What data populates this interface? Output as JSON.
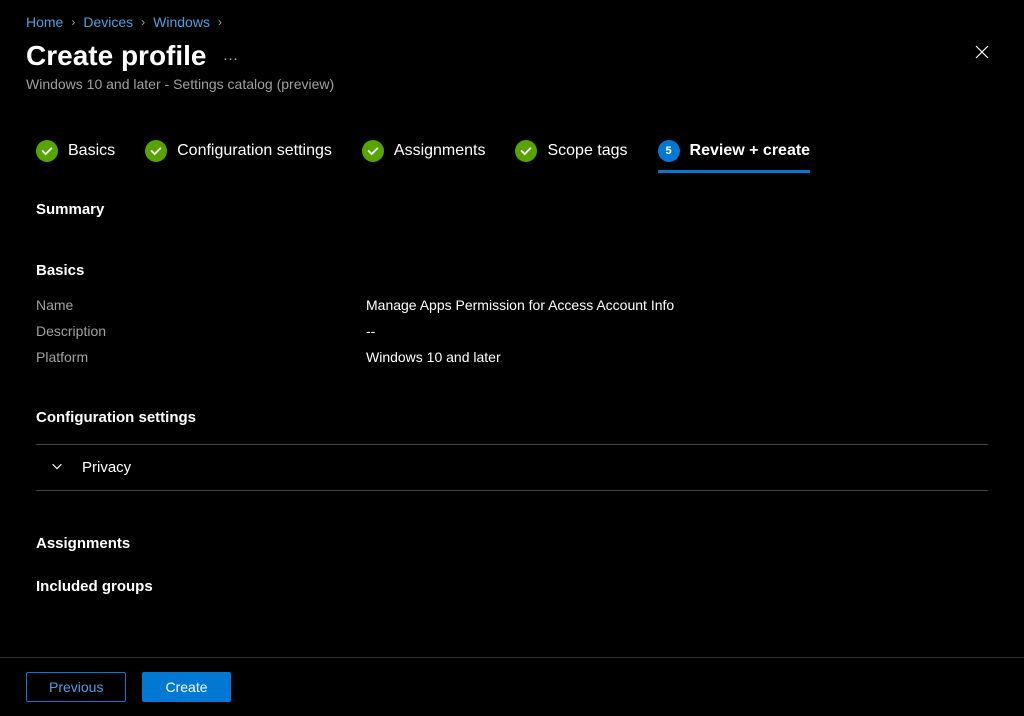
{
  "breadcrumb": {
    "items": [
      "Home",
      "Devices",
      "Windows"
    ]
  },
  "header": {
    "title": "Create profile",
    "subtitle": "Windows 10 and later - Settings catalog (preview)"
  },
  "steps": {
    "items": [
      {
        "label": "Basics",
        "state": "done"
      },
      {
        "label": "Configuration settings",
        "state": "done"
      },
      {
        "label": "Assignments",
        "state": "done"
      },
      {
        "label": "Scope tags",
        "state": "done"
      },
      {
        "label": "Review + create",
        "state": "active",
        "num": "5"
      }
    ]
  },
  "summary": {
    "heading": "Summary",
    "basics": {
      "heading": "Basics",
      "name_label": "Name",
      "name_value": "Manage Apps Permission for Access Account Info",
      "desc_label": "Description",
      "desc_value": "--",
      "platform_label": "Platform",
      "platform_value": "Windows 10 and later"
    },
    "config": {
      "heading": "Configuration settings",
      "expando_label": "Privacy"
    },
    "assignments": {
      "heading": "Assignments",
      "included_heading": "Included groups"
    }
  },
  "footer": {
    "previous": "Previous",
    "create": "Create"
  }
}
